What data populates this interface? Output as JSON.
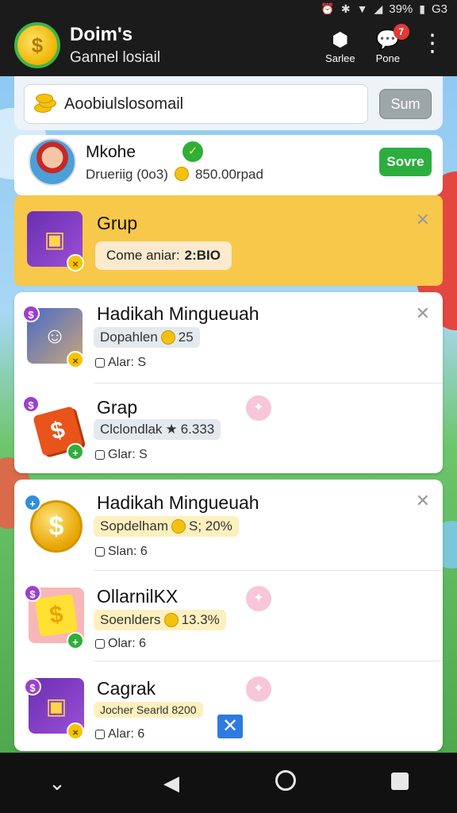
{
  "status_bar": {
    "battery": "39%",
    "time": "G3"
  },
  "header": {
    "title": "Doim's",
    "subtitle": "Gannel losiail",
    "actions": [
      {
        "label": "Sarlee",
        "icon": "controller-icon"
      },
      {
        "label": "Pone",
        "icon": "chat-icon",
        "badge": "7"
      }
    ]
  },
  "search": {
    "text": "Aoobiulslosomail",
    "button": "Sum"
  },
  "profile": {
    "name": "Mkohe",
    "meta_left": "Drueriig (0o3)",
    "meta_right": "850.00rpad",
    "button": "Sovre"
  },
  "highlight": {
    "title": "Grup",
    "pill_prefix": "Come aniar:",
    "pill_value": "2:BIO"
  },
  "group1": [
    {
      "title": "Hadikah Mingueuah",
      "sub": "Dopahlen",
      "sub_value": "25",
      "meta": "Alar: S"
    },
    {
      "title": "Grap",
      "sub": "Clclondlak",
      "sub_value": "6.333",
      "meta": "Glar: S"
    }
  ],
  "group2": [
    {
      "title": "Hadikah Mingueuah",
      "sub": "Sopdelham",
      "sub_value": "S; 20%",
      "meta": "Slan: 6"
    },
    {
      "title": "OllarnilKX",
      "sub": "Soenlders",
      "sub_value": "13.3%",
      "meta": "Olar: 6"
    },
    {
      "title": "Cagrak",
      "sub": "Jocher Searld",
      "sub_value": "8200",
      "meta": "Alar: 6"
    }
  ],
  "colors": {
    "accent_green": "#2cae3f",
    "highlight_yellow": "#f7c84a",
    "badge_red": "#e53935",
    "close_blue": "#2d7be0"
  }
}
